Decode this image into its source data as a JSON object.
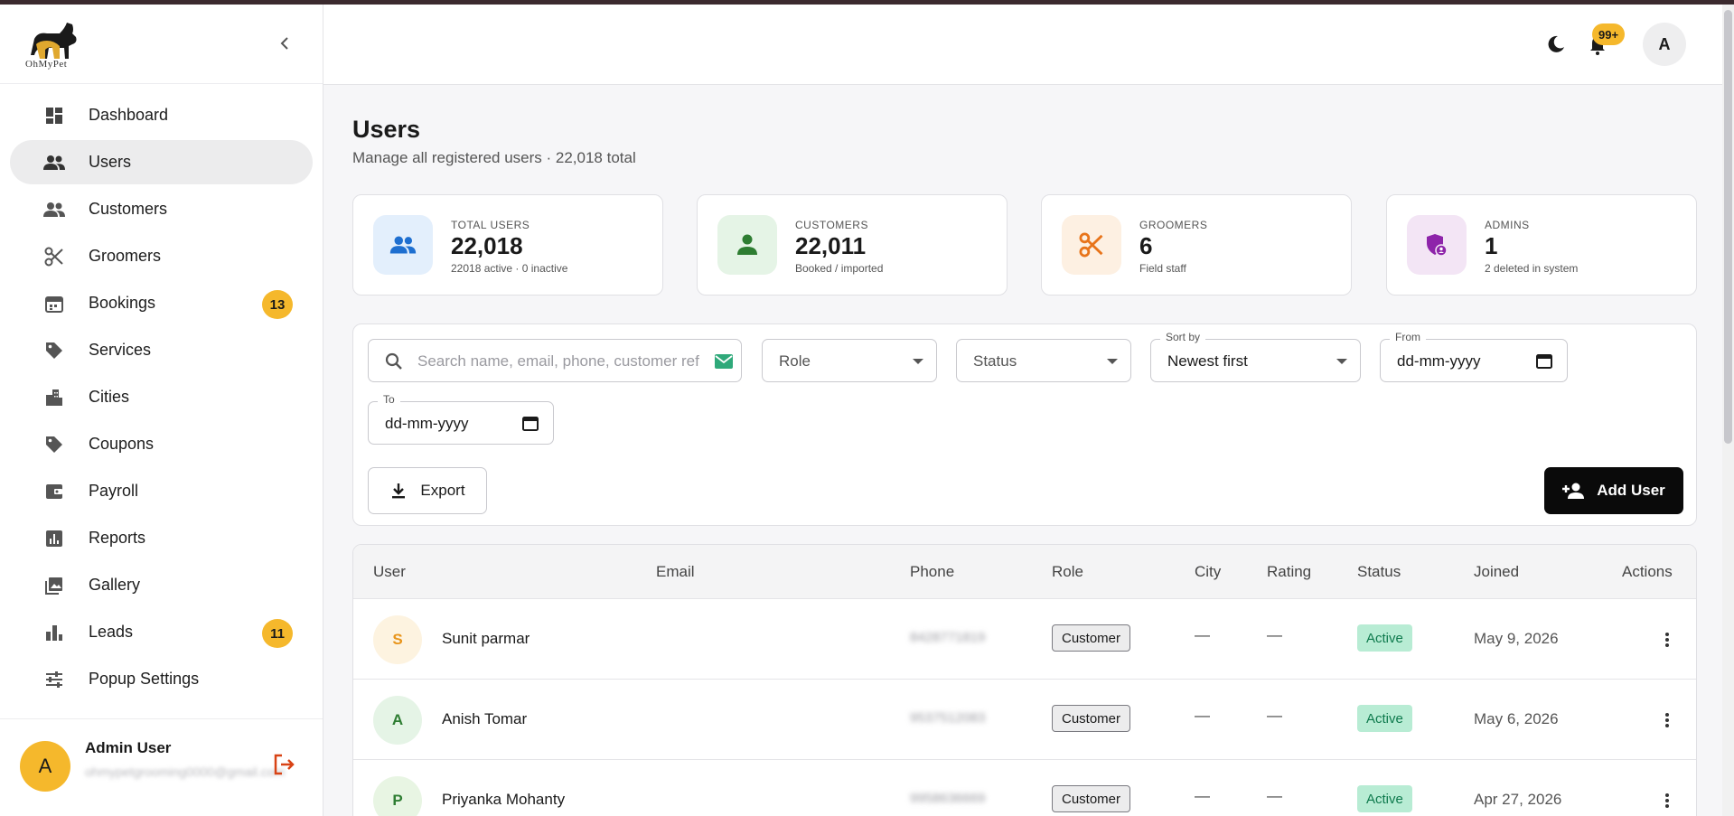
{
  "app": {
    "logo_text": "OhMyPet"
  },
  "sidebar": {
    "items": [
      {
        "label": "Dashboard",
        "icon": "dashboard-icon"
      },
      {
        "label": "Users",
        "icon": "users-icon",
        "active": true
      },
      {
        "label": "Customers",
        "icon": "customers-icon"
      },
      {
        "label": "Groomers",
        "icon": "scissors-icon"
      },
      {
        "label": "Bookings",
        "icon": "calendar-icon",
        "badge": "13"
      },
      {
        "label": "Services",
        "icon": "tag-icon"
      },
      {
        "label": "Cities",
        "icon": "city-icon"
      },
      {
        "label": "Coupons",
        "icon": "tag-icon"
      },
      {
        "label": "Payroll",
        "icon": "wallet-icon"
      },
      {
        "label": "Reports",
        "icon": "report-icon"
      },
      {
        "label": "Gallery",
        "icon": "gallery-icon"
      },
      {
        "label": "Leads",
        "icon": "bar-chart-icon",
        "badge": "11"
      },
      {
        "label": "Popup Settings",
        "icon": "sliders-icon"
      }
    ],
    "footer": {
      "avatar_letter": "A",
      "name": "Admin User",
      "email": "ohmypetgrooming0000@gmail.com"
    }
  },
  "topbar": {
    "notification_count": "99+",
    "avatar_letter": "A"
  },
  "page": {
    "title": "Users",
    "subtitle": "Manage all registered users · 22,018 total"
  },
  "stats": [
    {
      "label": "TOTAL USERS",
      "value": "22,018",
      "note": "22018 active · 0 inactive",
      "icon": "users-icon",
      "color": "#1e6fd0",
      "bg": "#e3effc"
    },
    {
      "label": "CUSTOMERS",
      "value": "22,011",
      "note": "Booked / imported",
      "icon": "person-icon",
      "color": "#2e7d32",
      "bg": "#e5f4e6"
    },
    {
      "label": "GROOMERS",
      "value": "6",
      "note": "Field staff",
      "icon": "scissors-icon",
      "color": "#e8741a",
      "bg": "#fdf0e2"
    },
    {
      "label": "ADMINS",
      "value": "1",
      "note": "2 deleted in system",
      "icon": "admin-shield-icon",
      "color": "#8e24aa",
      "bg": "#f3e5f5"
    }
  ],
  "filters": {
    "search_placeholder": "Search name, email, phone, customer ref",
    "role_placeholder": "Role",
    "status_placeholder": "Status",
    "sort_label": "Sort by",
    "sort_value": "Newest first",
    "from_label": "From",
    "from_value": "dd-mm-yyyy",
    "to_label": "To",
    "to_value": "dd-mm-yyyy",
    "export_label": "Export",
    "add_label": "Add User"
  },
  "table": {
    "columns": [
      "User",
      "Email",
      "Phone",
      "Role",
      "City",
      "Rating",
      "Status",
      "Joined",
      "Actions"
    ],
    "rows": [
      {
        "initial": "S",
        "name": "Sunit parmar",
        "phone": "8428771819",
        "role": "Customer",
        "city": "—",
        "rating": "—",
        "status": "Active",
        "joined": "May 9, 2026",
        "avatar_color": "#e8941a",
        "avatar_bg": "#fdf3e0"
      },
      {
        "initial": "A",
        "name": "Anish Tomar",
        "phone": "9537512083",
        "role": "Customer",
        "city": "—",
        "rating": "—",
        "status": "Active",
        "joined": "May 6, 2026",
        "avatar_color": "#2e7d32",
        "avatar_bg": "#e5f4e6"
      },
      {
        "initial": "P",
        "name": "Priyanka Mohanty",
        "phone": "9958636669",
        "role": "Customer",
        "city": "—",
        "rating": "—",
        "status": "Active",
        "joined": "Apr 27, 2026",
        "avatar_color": "#2e7d32",
        "avatar_bg": "#e8f5e3"
      }
    ]
  }
}
